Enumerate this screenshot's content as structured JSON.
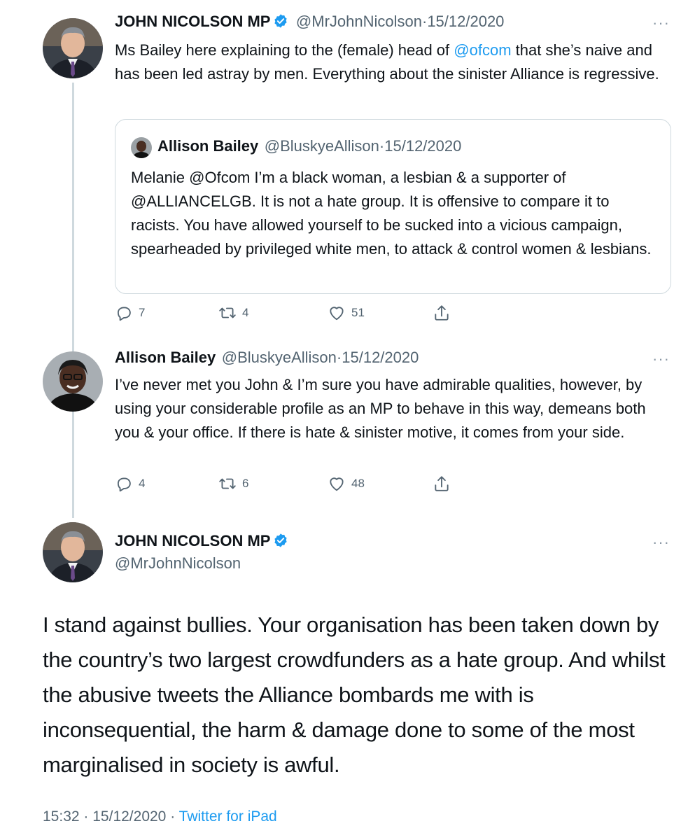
{
  "tweet1": {
    "name": "JOHN NICOLSON MP",
    "handle": "@MrJohnNicolson",
    "date": "15/12/2020",
    "text_before": "Ms Bailey here explaining to the (female) head of ",
    "mention": "@ofcom",
    "text_after": " that she’s naive and has been led astray by men. Everything about the sinister Alliance is regressive.",
    "more": "···",
    "quote": {
      "name": "Allison Bailey",
      "handle": "@BluskyeAllison",
      "date": "15/12/2020",
      "text": "Melanie @Ofcom I’m a black woman, a lesbian & a supporter of @ALLIANCELGB. It is not a hate group. It is offensive to compare it to racists. You have allowed yourself to be sucked into a vicious campaign, spearheaded by privileged white men, to attack & control women & lesbians."
    },
    "replies": "7",
    "retweets": "4",
    "likes": "51"
  },
  "tweet2": {
    "name": "Allison Bailey",
    "handle": "@BluskyeAllison",
    "date": "15/12/2020",
    "text": "I’ve never met you John & I’m sure you have admirable qualities, however, by using your considerable profile as an MP to behave in this way, demeans both you & your office. If there is hate & sinister motive, it comes from your side.",
    "more": "···",
    "replies": "4",
    "retweets": "6",
    "likes": "48"
  },
  "main_tweet": {
    "name": "JOHN NICOLSON MP",
    "handle": "@MrJohnNicolson",
    "more": "···",
    "text": "I stand against bullies. Your organisation has been taken down by the country’s two largest crowdfunders as a hate group. And whilst the abusive tweets the Alliance bombards me with is inconsequential, the harm & damage done to some of the most marginalised in society is awful.",
    "time": "15:32",
    "date": "15/12/2020",
    "source": "Twitter for iPad"
  },
  "colors": {
    "accent": "#1d9bf0",
    "secondary_text": "#536471",
    "border": "#cfd9de"
  },
  "icons": [
    "verified-badge-icon",
    "reply-icon",
    "retweet-icon",
    "like-icon",
    "share-icon",
    "more-icon"
  ]
}
